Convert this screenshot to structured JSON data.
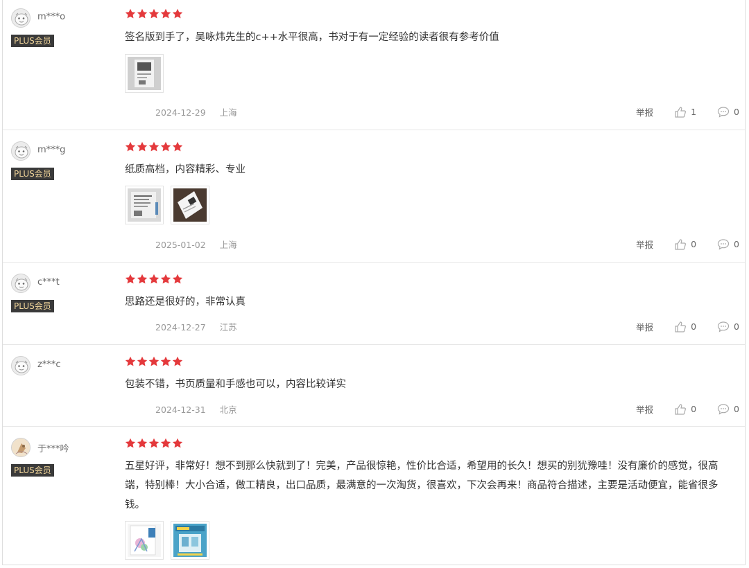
{
  "report_label": "举报",
  "reviews": [
    {
      "user": "m***o",
      "plus": "PLUS会员",
      "content": "签名版到手了，吴咏炜先生的c++水平很高，书对于有一定经验的读者很有参考价值",
      "date": "2024-12-29",
      "location": "上海",
      "likes": "1",
      "comments": "0",
      "images": [
        "photo-book-signed"
      ]
    },
    {
      "user": "m***g",
      "plus": "PLUS会员",
      "content": "纸质高档，内容精彩、专业",
      "date": "2025-01-02",
      "location": "上海",
      "likes": "0",
      "comments": "0",
      "images": [
        "photo-book-back",
        "photo-book-angle"
      ]
    },
    {
      "user": "c***t",
      "plus": "PLUS会员",
      "content": "思路还是很好的，非常认真",
      "date": "2024-12-27",
      "location": "江苏",
      "likes": "0",
      "comments": "0",
      "images": []
    },
    {
      "user": "z***c",
      "plus": "",
      "content": "包装不错，书页质量和手感也可以，内容比较详实",
      "date": "2024-12-31",
      "location": "北京",
      "likes": "0",
      "comments": "0",
      "images": []
    },
    {
      "user": "于***吟",
      "plus": "PLUS会员",
      "content": "五星好评，非常好！想不到那么快就到了！完美，产品很惊艳，性价比合适，希望用的长久！想买的别犹豫哇！没有廉价的感觉，很高端，特别棒！大小合适，做工精良，出口品质，最满意的一次淘货，很喜欢，下次会再来！商品符合描述，主要是活动便宜，能省很多钱。",
      "date": "",
      "location": "",
      "likes": "",
      "comments": "",
      "images": [
        "photo-book-cover",
        "photo-book-promo"
      ]
    }
  ],
  "colors": {
    "star": "#e4393c",
    "plus_bg": "#3a3a3a",
    "plus_text": "#f1d59a"
  },
  "rating": 5
}
